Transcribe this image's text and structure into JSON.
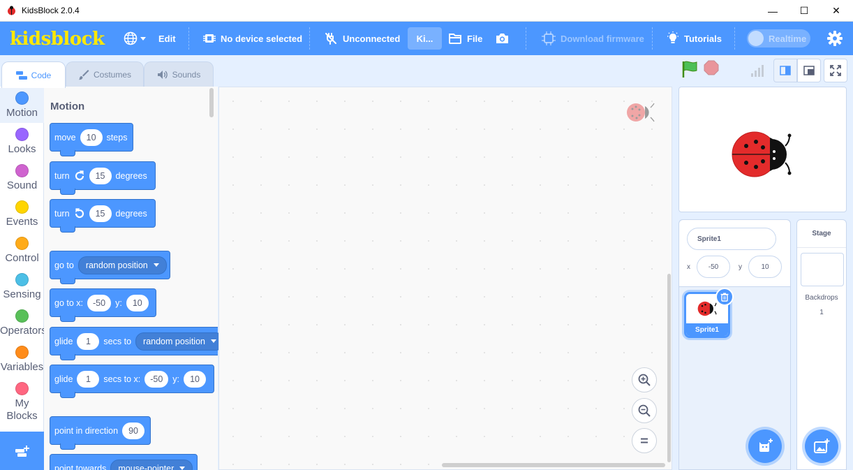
{
  "window": {
    "title": "KidsBlock 2.0.4",
    "minimize": "—",
    "maximize": "☐",
    "close": "✕"
  },
  "menubar": {
    "logo": "kidsblock",
    "edit": "Edit",
    "device": "No device selected",
    "connection": "Unconnected",
    "kit": "Ki...",
    "file": "File",
    "download_firmware": "Download firmware",
    "tutorials": "Tutorials",
    "realtime": "Realtime"
  },
  "tabs": [
    {
      "label": "Code"
    },
    {
      "label": "Costumes"
    },
    {
      "label": "Sounds"
    }
  ],
  "categories": [
    {
      "label": "Motion",
      "color": "#4c97ff"
    },
    {
      "label": "Looks",
      "color": "#9966ff"
    },
    {
      "label": "Sound",
      "color": "#cf63cf"
    },
    {
      "label": "Events",
      "color": "#ffd500"
    },
    {
      "label": "Control",
      "color": "#ffab19"
    },
    {
      "label": "Sensing",
      "color": "#4cbfe6"
    },
    {
      "label": "Operators",
      "color": "#59c059"
    },
    {
      "label": "Variables",
      "color": "#ff8c1a"
    },
    {
      "label": "My Blocks",
      "color": "#ff6680"
    }
  ],
  "palette": {
    "title": "Motion",
    "move": {
      "a": "move",
      "v": "10",
      "b": "steps"
    },
    "turn_right": {
      "a": "turn",
      "v": "15",
      "b": "degrees"
    },
    "turn_left": {
      "a": "turn",
      "v": "15",
      "b": "degrees"
    },
    "goto": {
      "a": "go to",
      "opt": "random position"
    },
    "gotoxy": {
      "a": "go to x:",
      "x": "-50",
      "b": "y:",
      "y": "10"
    },
    "glide": {
      "a": "glide",
      "v": "1",
      "b": "secs to",
      "opt": "random position"
    },
    "glidexy": {
      "a": "glide",
      "v": "1",
      "b": "secs to x:",
      "x": "-50",
      "c": "y:",
      "y": "10"
    },
    "point": {
      "a": "point in direction",
      "v": "90"
    },
    "point_towards": {
      "a": "point towards",
      "opt": "mouse-pointer"
    }
  },
  "sprite": {
    "name": "Sprite1",
    "x_label": "x",
    "x": "-50",
    "y_label": "y",
    "y": "10",
    "thumb_name": "Sprite1"
  },
  "stage_pane": {
    "title": "Stage",
    "backdrops_label": "Backdrops",
    "backdrops_count": "1"
  }
}
